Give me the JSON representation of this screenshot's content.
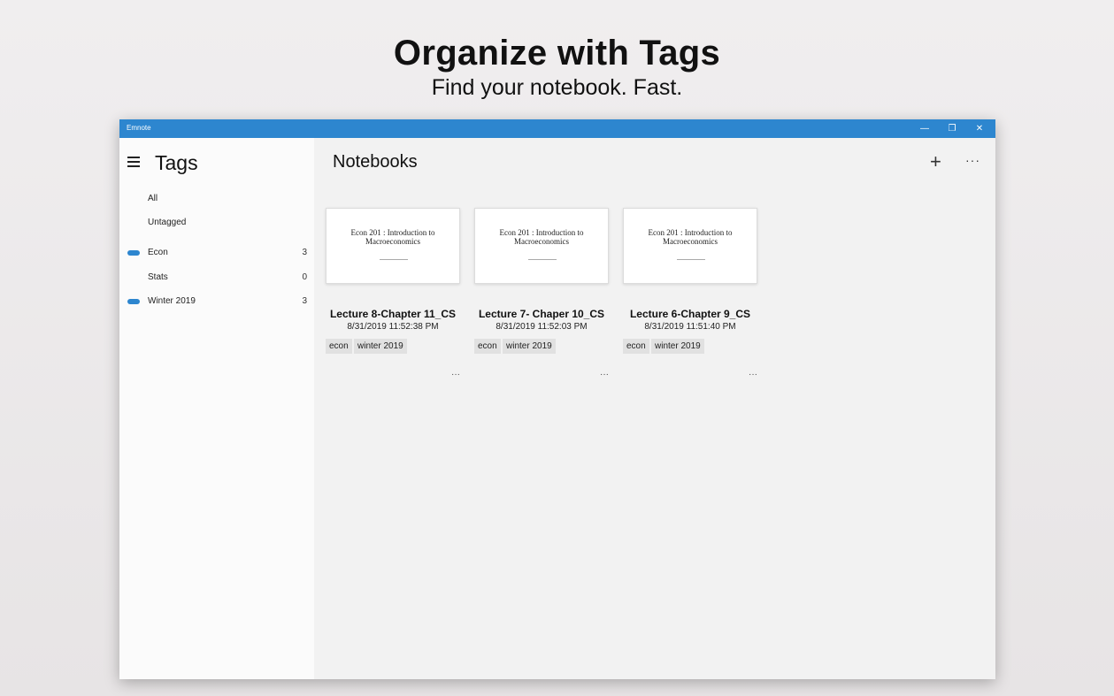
{
  "hero": {
    "title": "Organize with Tags",
    "subtitle": "Find your notebook. Fast."
  },
  "window": {
    "app_title": "Emnote",
    "minimize_glyph": "—",
    "maximize_glyph": "❐",
    "close_glyph": "✕"
  },
  "sidebar": {
    "title": "Tags",
    "items": [
      {
        "label": "All",
        "count": "",
        "colored": false
      },
      {
        "label": "Untagged",
        "count": "",
        "colored": false
      },
      {
        "label": "Econ",
        "count": "3",
        "colored": true
      },
      {
        "label": "Stats",
        "count": "0",
        "colored": false
      },
      {
        "label": "Winter 2019",
        "count": "3",
        "colored": true
      }
    ],
    "tag_color": "#2d86cf"
  },
  "main": {
    "title": "Notebooks",
    "add_glyph": "+",
    "more_glyph": "···",
    "notebooks": [
      {
        "thumb_title": "Econ 201 : Introduction to Macroeconomics",
        "name": "Lecture 8-Chapter 11_CS",
        "date": "8/31/2019 11:52:38 PM",
        "tags": [
          "econ",
          "winter 2019"
        ],
        "more": "···"
      },
      {
        "thumb_title": "Econ 201 : Introduction to Macroeconomics",
        "name": "Lecture 7- Chaper 10_CS",
        "date": "8/31/2019 11:52:03 PM",
        "tags": [
          "econ",
          "winter 2019"
        ],
        "more": "···"
      },
      {
        "thumb_title": "Econ 201 : Introduction to Macroeconomics",
        "name": "Lecture 6-Chapter 9_CS",
        "date": "8/31/2019 11:51:40 PM",
        "tags": [
          "econ",
          "winter 2019"
        ],
        "more": "···"
      }
    ]
  },
  "colors": {
    "accent": "#2d86cf",
    "sidebar_bg": "#fbfbfb",
    "content_bg": "#f2f2f2"
  }
}
